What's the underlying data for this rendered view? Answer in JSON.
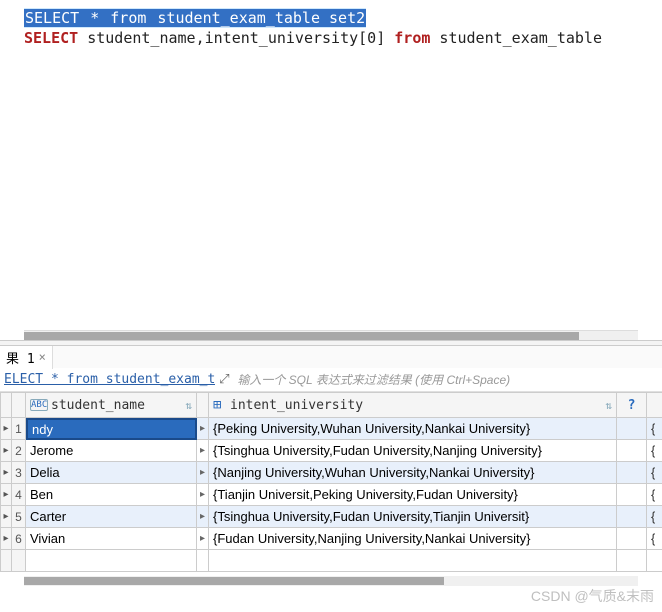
{
  "editor": {
    "line1": {
      "select": "SELECT",
      "star": " * ",
      "from": "from",
      "rest": " student_exam_table set2"
    },
    "line2": {
      "select": "SELECT",
      "cols": " student_name,intent_university[0] ",
      "from": "from",
      "rest": " student_exam_table"
    }
  },
  "result_tab": {
    "label": "果 1",
    "close": "×"
  },
  "filter_bar": {
    "sql_preview": "ELECT * from student_exam_t",
    "expand_glyph": "⤢",
    "placeholder": "输入一个 SQL 表达式来过滤结果 (使用 Ctrl+Space)"
  },
  "grid": {
    "columns": {
      "name": {
        "icon": "ABC",
        "label": "student_name",
        "filter_glyph": "⇅"
      },
      "univ": {
        "label": "intent_university",
        "filter_glyph": "⇅"
      },
      "help_glyph": "?"
    },
    "row_marker": "▸",
    "expand_marker": "▸",
    "rows": [
      {
        "n": "1",
        "name": "ndy",
        "univ": "{Peking University,Wuhan University,Nankai University}",
        "extra": "{\"C"
      },
      {
        "n": "2",
        "name": "Jerome",
        "univ": "{Tsinghua University,Fudan University,Nanjing University}",
        "extra": "{\"H"
      },
      {
        "n": "3",
        "name": "Delia",
        "univ": "{Nanjing University,Wuhan University,Nankai University}",
        "extra": "{\"C"
      },
      {
        "n": "4",
        "name": "Ben",
        "univ": "{Tianjin Universit,Peking University,Fudan University}",
        "extra": "{\"C"
      },
      {
        "n": "5",
        "name": "Carter",
        "univ": "{Tsinghua University,Fudan University,Tianjin Universit}",
        "extra": "{\"H"
      },
      {
        "n": "6",
        "name": "Vivian",
        "univ": "{Fudan University,Nanjing University,Nankai University}",
        "extra": "{\"H"
      }
    ]
  },
  "watermark": "CSDN @气质&末雨"
}
